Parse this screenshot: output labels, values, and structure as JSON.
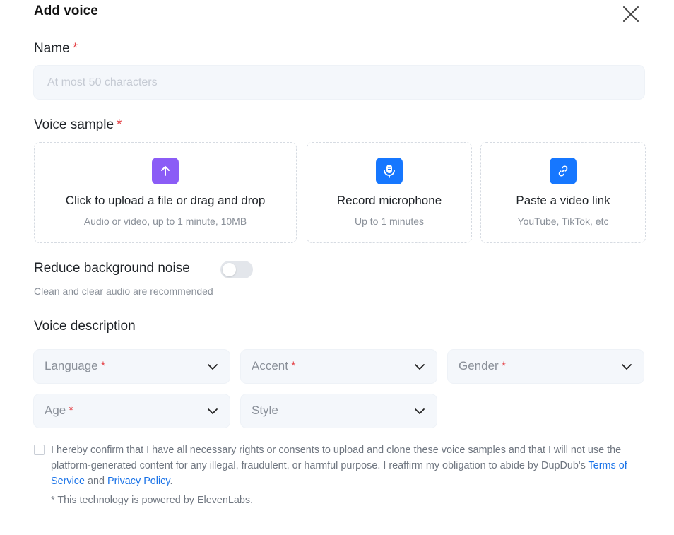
{
  "dialog": {
    "title": "Add voice"
  },
  "name_field": {
    "label": "Name",
    "required_mark": "*",
    "placeholder": "At most 50 characters",
    "value": ""
  },
  "voice_sample": {
    "label": "Voice sample",
    "required_mark": "*",
    "options": [
      {
        "title": "Click to upload a file or drag and drop",
        "subtitle": "Audio or video, up to 1 minute, 10MB",
        "icon": "upload-arrow-icon",
        "color": "#8b5cf6"
      },
      {
        "title": "Record microphone",
        "subtitle": "Up to 1 minutes",
        "icon": "microphone-icon",
        "color": "#1677ff"
      },
      {
        "title": "Paste a video link",
        "subtitle": "YouTube, TikTok, etc",
        "icon": "link-icon",
        "color": "#1677ff"
      }
    ]
  },
  "noise": {
    "label": "Reduce background noise",
    "enabled": false,
    "hint": "Clean and clear audio are recommended"
  },
  "voice_description": {
    "label": "Voice description",
    "required_mark": "*",
    "selects": [
      {
        "label": "Language",
        "required": true
      },
      {
        "label": "Accent",
        "required": true
      },
      {
        "label": "Gender",
        "required": true
      },
      {
        "label": "Age",
        "required": true
      },
      {
        "label": "Style",
        "required": false
      }
    ]
  },
  "consent": {
    "checked": false,
    "text_before": "I hereby confirm that I have all necessary rights or consents to upload and clone these voice samples and that I will not use the platform-generated content for any illegal, fraudulent, or harmful purpose. I reaffirm my obligation to abide by DupDub's ",
    "terms_link": "Terms of Service",
    "and_text": " and ",
    "privacy_link": "Privacy Policy",
    "end_text": "."
  },
  "footer": {
    "powered_by": "* This technology is powered by ElevenLabs."
  },
  "colors": {
    "accent": "#1677ff",
    "required": "#e5484d",
    "link": "#1a73e8"
  }
}
